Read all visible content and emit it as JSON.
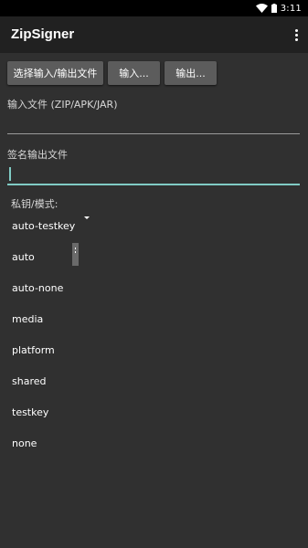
{
  "status_bar": {
    "time": "3:11",
    "wifi_icon": "wifi-icon",
    "battery_icon": "battery-icon"
  },
  "app_bar": {
    "title": "ZipSigner",
    "overflow_icon": "more-vert-icon"
  },
  "buttons": {
    "select_io": "选择输入/输出文件",
    "input": "输入...",
    "output": "输出..."
  },
  "input_file": {
    "label": "输入文件 (ZIP/APK/JAR)",
    "value": ""
  },
  "output_file": {
    "label": "签名输出文件",
    "value": ""
  },
  "key_mode": {
    "label": "私钥/模式:",
    "selected": "auto-testkey",
    "options": [
      "auto-testkey",
      "auto",
      "auto-none",
      "media",
      "platform",
      "shared",
      "testkey",
      "none"
    ]
  },
  "colors": {
    "background": "#303030",
    "app_bar": "#212121",
    "accent": "#80cbc4",
    "button": "#5c5c5c"
  }
}
